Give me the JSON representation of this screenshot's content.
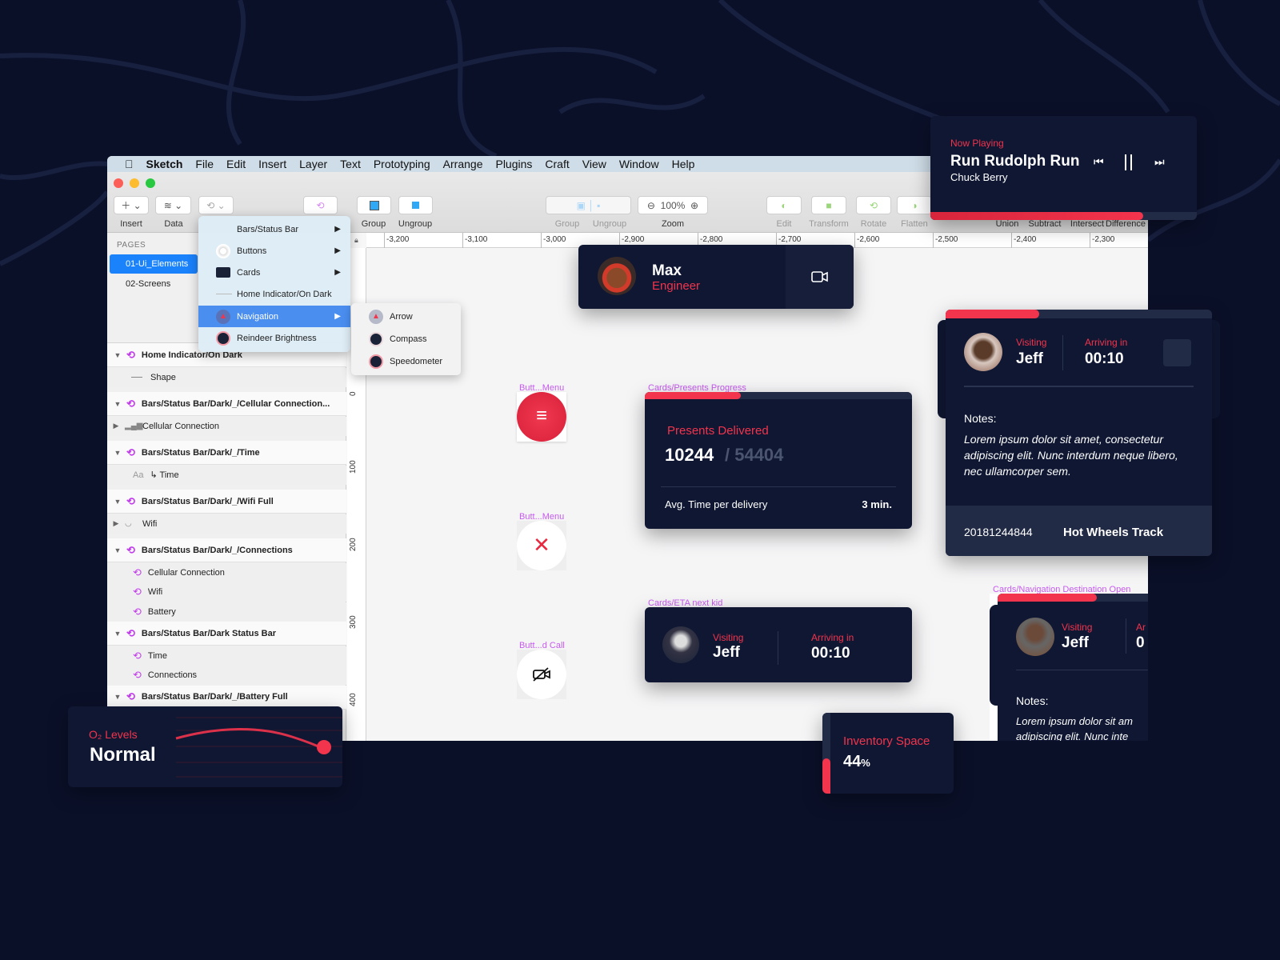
{
  "menubar": {
    "app": "Sketch",
    "items": [
      "File",
      "Edit",
      "Insert",
      "Layer",
      "Text",
      "Prototyping",
      "Arrange",
      "Plugins",
      "Craft",
      "View",
      "Window",
      "Help"
    ]
  },
  "toolbar": {
    "insert": "Insert",
    "data": "Data",
    "group": "Group",
    "ungroup": "Ungroup",
    "group2": "Group",
    "ungroup2": "Ungroup",
    "zoom_value": "100%",
    "zoom": "Zoom",
    "edit": "Edit",
    "transform": "Transform",
    "rotate": "Rotate",
    "flatten": "Flatten",
    "union": "Union",
    "subtract": "Subtract",
    "intersect": "Intersect",
    "difference": "Difference"
  },
  "pages": {
    "header": "PAGES",
    "items": [
      "01-Ui_Elements",
      "02-Screens"
    ],
    "selected": "01-Ui_Elements"
  },
  "layers": [
    {
      "label": "Home Indicator/On Dark",
      "type": "group"
    },
    {
      "label": "Shape",
      "type": "shape"
    },
    {
      "label": "Bars/Status Bar/Dark/_/Cellular Connection...",
      "type": "group"
    },
    {
      "label": "Cellular Connection",
      "type": "collapsed"
    },
    {
      "label": "Bars/Status Bar/Dark/_/Time",
      "type": "group"
    },
    {
      "label": "↳ Time",
      "type": "text",
      "prefix": "Aa"
    },
    {
      "label": "Bars/Status Bar/Dark/_/Wifi Full",
      "type": "group"
    },
    {
      "label": "Wifi",
      "type": "collapsed"
    },
    {
      "label": "Bars/Status Bar/Dark/_/Connections",
      "type": "group"
    },
    {
      "label": "Cellular Connection",
      "type": "symbol"
    },
    {
      "label": "Wifi",
      "type": "symbol"
    },
    {
      "label": "Battery",
      "type": "symbol"
    },
    {
      "label": "Bars/Status Bar/Dark Status Bar",
      "type": "group"
    },
    {
      "label": "Time",
      "type": "symbol"
    },
    {
      "label": "Connections",
      "type": "symbol"
    },
    {
      "label": "Bars/Status Bar/Dark/_/Battery Full",
      "type": "group"
    }
  ],
  "ruler": {
    "top": [
      "-3,200",
      "-3,100",
      "-3,000",
      "-2,900",
      "-2,800",
      "-2,700",
      "-2,600",
      "-2,500",
      "-2,400",
      "-2,300"
    ],
    "left": [
      "0",
      "100",
      "200",
      "300",
      "400"
    ]
  },
  "dropdown": {
    "items": [
      "Bars/Status Bar",
      "Buttons",
      "Cards",
      "Home Indicator/On Dark",
      "Navigation",
      "Reindeer Brightness"
    ],
    "highlighted": "Navigation",
    "submenu": [
      "Arrow",
      "Compass",
      "Speedometer"
    ]
  },
  "canvas": {
    "button_labels": [
      "Butt...Menu",
      "Butt...Menu",
      "Butt...d Call"
    ],
    "profile": {
      "name": "Max",
      "role": "Engineer"
    },
    "presents": {
      "label": "Cards/Presents Progress",
      "title": "Presents Delivered",
      "delivered": "10244",
      "total": "/ 54404",
      "avg_label": "Avg. Time per delivery",
      "avg_value": "3 min.",
      "progress": 0.36
    },
    "eta": {
      "label": "Cards/ETA next kid",
      "visiting": "Visiting",
      "name": "Jeff",
      "arriving": "Arriving in",
      "time": "00:10"
    },
    "nav_dest": {
      "label": "Cards/Navigation Destination Open",
      "visiting": "Visiting",
      "name": "Jeff",
      "arriving": "Ar",
      "time": "0",
      "notes": "Notes:",
      "notes_text": "Lorem ipsum dolor sit am",
      "notes_text2": "adipiscing elit. Nunc inte",
      "progress": 0.62
    }
  },
  "now_playing": {
    "label": "Now Playing",
    "title": "Run Rudolph Run",
    "artist": "Chuck Berry",
    "progress": 0.8
  },
  "destination": {
    "visiting": "Visiting",
    "name": "Jeff",
    "arriving": "Arriving in",
    "time": "00:10",
    "notes": "Notes:",
    "notes_text": "Lorem ipsum dolor sit amet, consectetur adipiscing elit. Nunc interdum neque libero, nec ullamcorper sem.",
    "order_id": "20181244844",
    "item": "Hot Wheels Track",
    "progress": 0.35
  },
  "o2": {
    "label": "O₂ Levels",
    "value": "Normal"
  },
  "inventory": {
    "label": "Inventory Space",
    "value": "44",
    "unit": "%",
    "level": 0.44
  },
  "colors": {
    "bg": "#0b1029",
    "card": "#0f1733",
    "accent": "#f2344c",
    "selection": "#1a82fb",
    "symbol": "#c23dea"
  }
}
